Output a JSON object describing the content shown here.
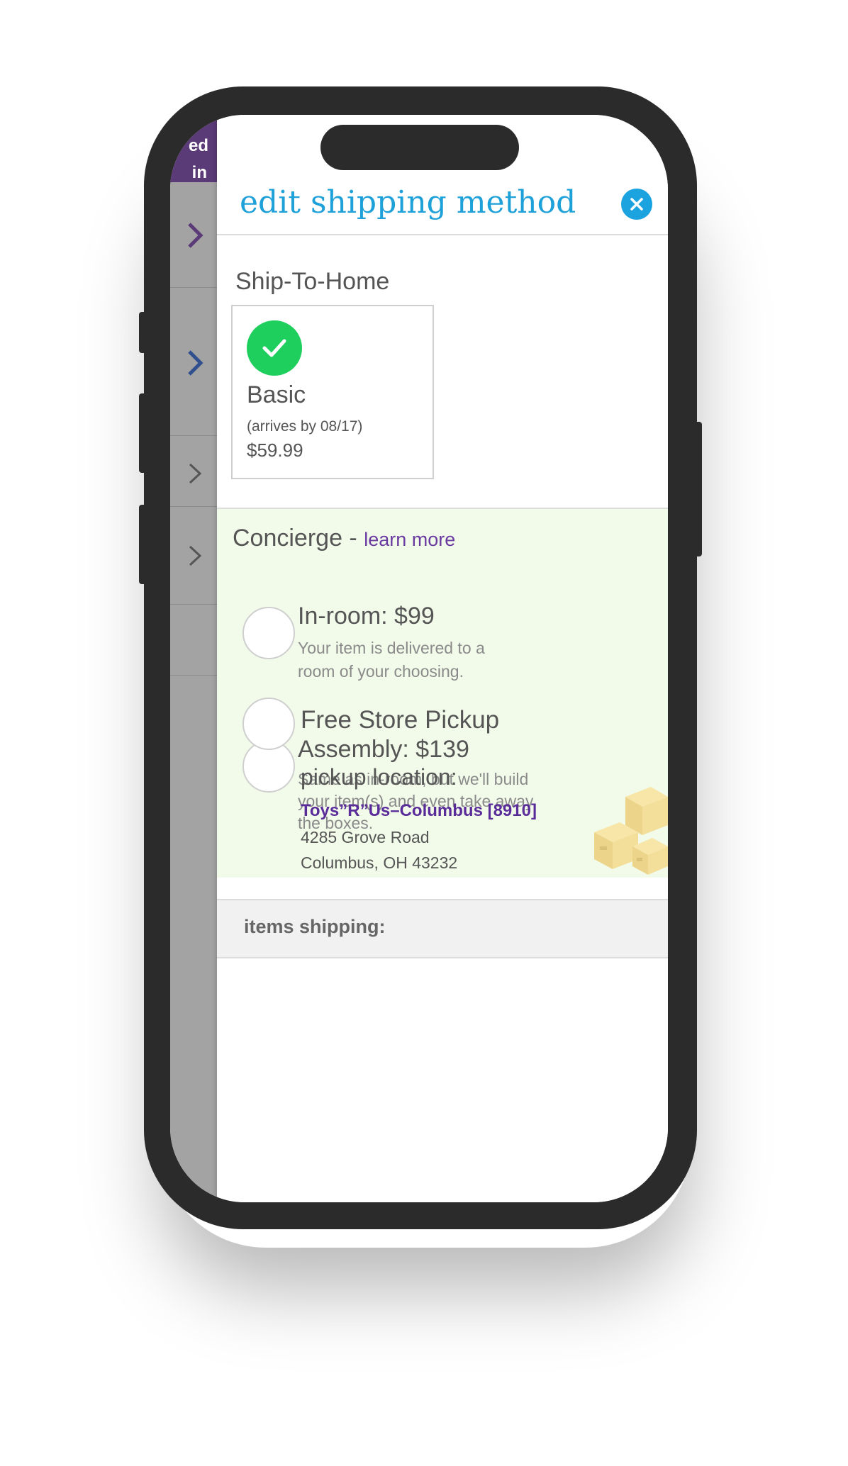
{
  "modal": {
    "title": "edit shipping method",
    "close_icon": "close-icon"
  },
  "ship_to_home": {
    "label": "Ship-To-Home",
    "option": {
      "name": "Basic",
      "arrival": "(arrives by 08/17)",
      "price": "$59.99",
      "selected": true
    }
  },
  "concierge": {
    "label": "Concierge",
    "separator": " - ",
    "learn_more": "learn more",
    "options": [
      {
        "title": "In-room: $99",
        "desc_lines": [
          "Your item is delivered to a",
          "room of your choosing."
        ]
      },
      {
        "title": "Assembly: $139",
        "desc_lines": [
          "Same as in-room, but we'll build",
          "your item(s) and even take away",
          "the boxes."
        ]
      }
    ]
  },
  "store_pickup": {
    "title": "Free Store Pickup",
    "location_label": "pickup location:",
    "store_name": "Toys”R”Us–Columbus [8910]",
    "address_line1": "4285 Grove Road",
    "address_line2": "Columbus, OH 43232"
  },
  "items_shipping": {
    "label": "items shipping:"
  },
  "background_page": {
    "banner_lines": [
      "ed",
      "in"
    ]
  },
  "colors": {
    "title_blue": "#1da1d8",
    "check_green": "#1fcf5e",
    "concierge_bg": "#f2fbea",
    "store_purple": "#5a2c9a",
    "banner_purple": "#5b3a78"
  }
}
